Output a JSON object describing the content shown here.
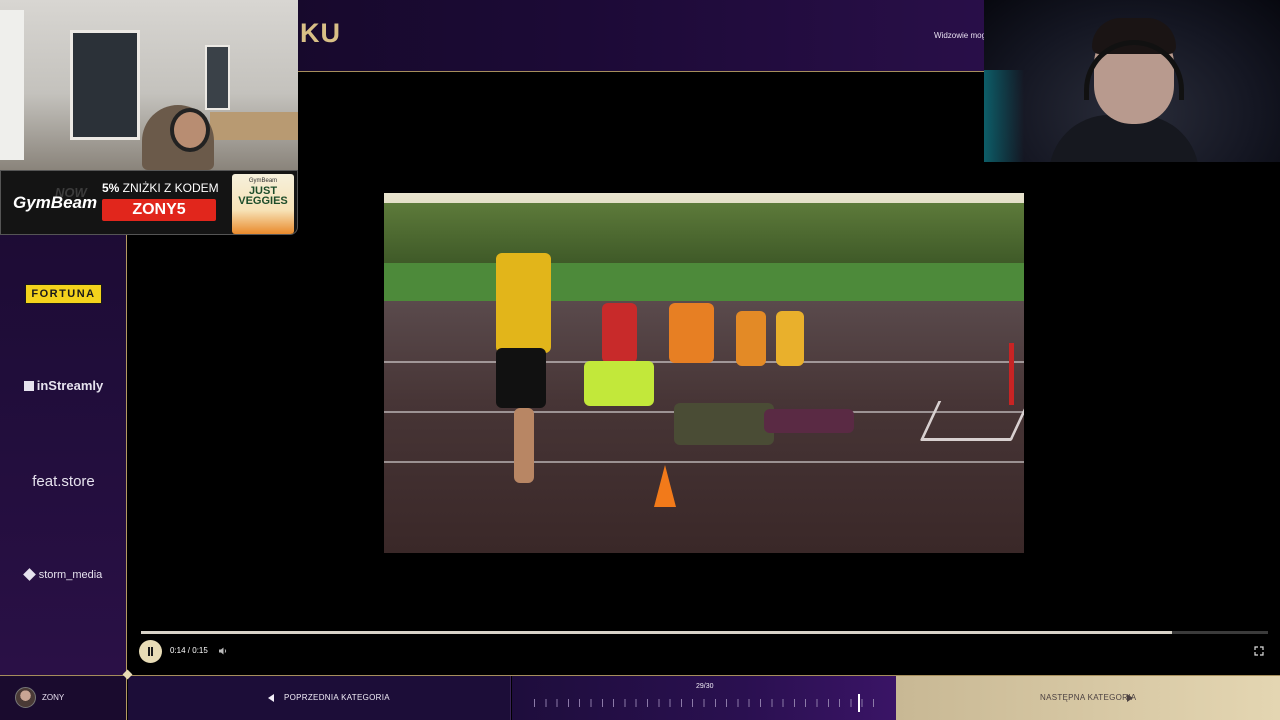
{
  "header": {
    "title": "KU",
    "top_right_text": "Widzowie mog"
  },
  "promo": {
    "brand": "GymBeam",
    "headline_percent": "5%",
    "headline_rest": " ZNIŻKI Z KODEM",
    "code": "ZONY5",
    "pack_brand": "GymBeam",
    "pack_title": "JUST VEGGIES"
  },
  "sponsors": {
    "fortuna": "FORTUNA",
    "instreamly": "inStreamly",
    "feat": "feat.store",
    "storm": "storm_media"
  },
  "player": {
    "time": "0:14 / 0:15",
    "progress": 0.915
  },
  "bottom": {
    "user": "ZONY",
    "prev_label": "POPRZEDNIA KATEGORIA",
    "counter": "29/30",
    "next_label": "NASTĘPNA KATEGORIA"
  },
  "colors": {
    "accent_gold": "#d8bf86",
    "promo_red": "#e1261c",
    "fortuna_yellow": "#f4d31c"
  },
  "icons": {
    "pause": "pause-icon",
    "volume": "volume-icon",
    "fullscreen": "fullscreen-icon",
    "prev_arrow": "arrow-left-icon",
    "next_arrow": "arrow-right-icon"
  }
}
